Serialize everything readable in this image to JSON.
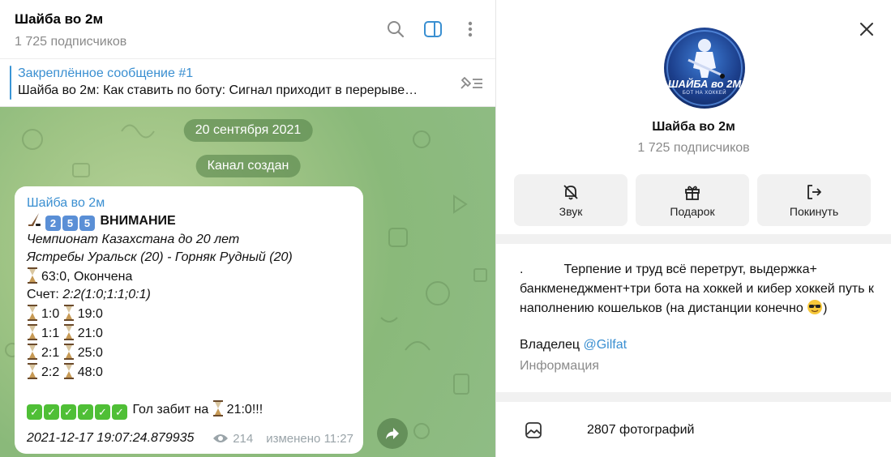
{
  "chat": {
    "title": "Шайба во 2м",
    "subscribers": "1 725 подписчиков"
  },
  "pinned": {
    "title": "Закреплённое сообщение #1",
    "text": "Шайба во 2м: Как ставить по боту: Сигнал приходит в перерыве…"
  },
  "service": {
    "date": "20 сентября 2021",
    "created": "Канал создан"
  },
  "message": {
    "author": "Шайба во 2м",
    "nums": [
      "2",
      "5",
      "5"
    ],
    "headline": "ВНИМАНИЕ",
    "league": "Чемпионат Казахстана до 20 лет",
    "match": "Ястребы Уральск (20) - Горняк Рудный (20)",
    "status": "63:0, Окончена",
    "score_label": "Счет:",
    "score_value": "2:2(1:0;1:1;0:1)",
    "goals": [
      {
        "score": "1:0",
        "time": "19:0"
      },
      {
        "score": "1:1",
        "time": "21:0"
      },
      {
        "score": "2:1",
        "time": "25:0"
      },
      {
        "score": "2:2",
        "time": "48:0"
      }
    ],
    "goal_text": "Гол забит на",
    "goal_time": "21:0!!!",
    "timestamp": "2021-12-17 19:07:24.879935",
    "views": "214",
    "edited": "изменено 11:27"
  },
  "info": {
    "avatar_text_main": "ШАЙБА во 2М",
    "avatar_text_sub": "БОТ НА ХОККЕЙ",
    "name": "Шайба во 2м",
    "subscribers": "1 725 подписчиков",
    "actions": [
      {
        "label": "Звук",
        "icon": "bell-off-icon"
      },
      {
        "label": "Подарок",
        "icon": "gift-icon"
      },
      {
        "label": "Покинуть",
        "icon": "leave-icon"
      }
    ],
    "desc_dot": ".",
    "desc_text": "Терпение и труд всё перетрут, выдержка+ банкменеджмент+три бота на хоккей и кибер хоккей путь к наполнению кошельков (на дистанции конечно",
    "desc_end": ")",
    "owner_label": "Владелец",
    "owner_link": "@Gilfat",
    "info_label": "Информация",
    "photos_label": "2807 фотографий"
  },
  "colors": {
    "accent": "#3a8fd1",
    "chat_bg": "#9fc485",
    "check": "#4fbf36",
    "num": "#5a8fd6"
  }
}
